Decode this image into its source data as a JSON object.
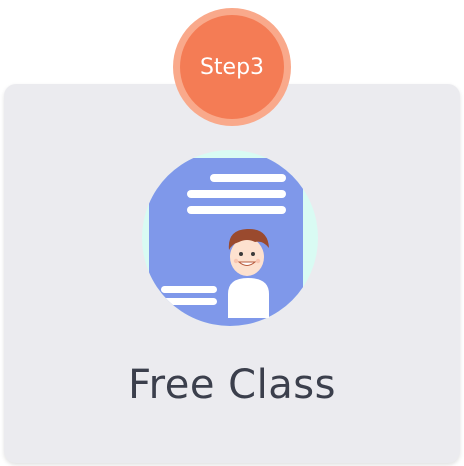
{
  "badge": {
    "label": "Step3",
    "color": "#f47c55"
  },
  "card": {
    "title": "Free Class",
    "background": "#ebebef"
  },
  "illustration": {
    "icon": "document-with-person-icon",
    "accent": "#7f98ea"
  }
}
